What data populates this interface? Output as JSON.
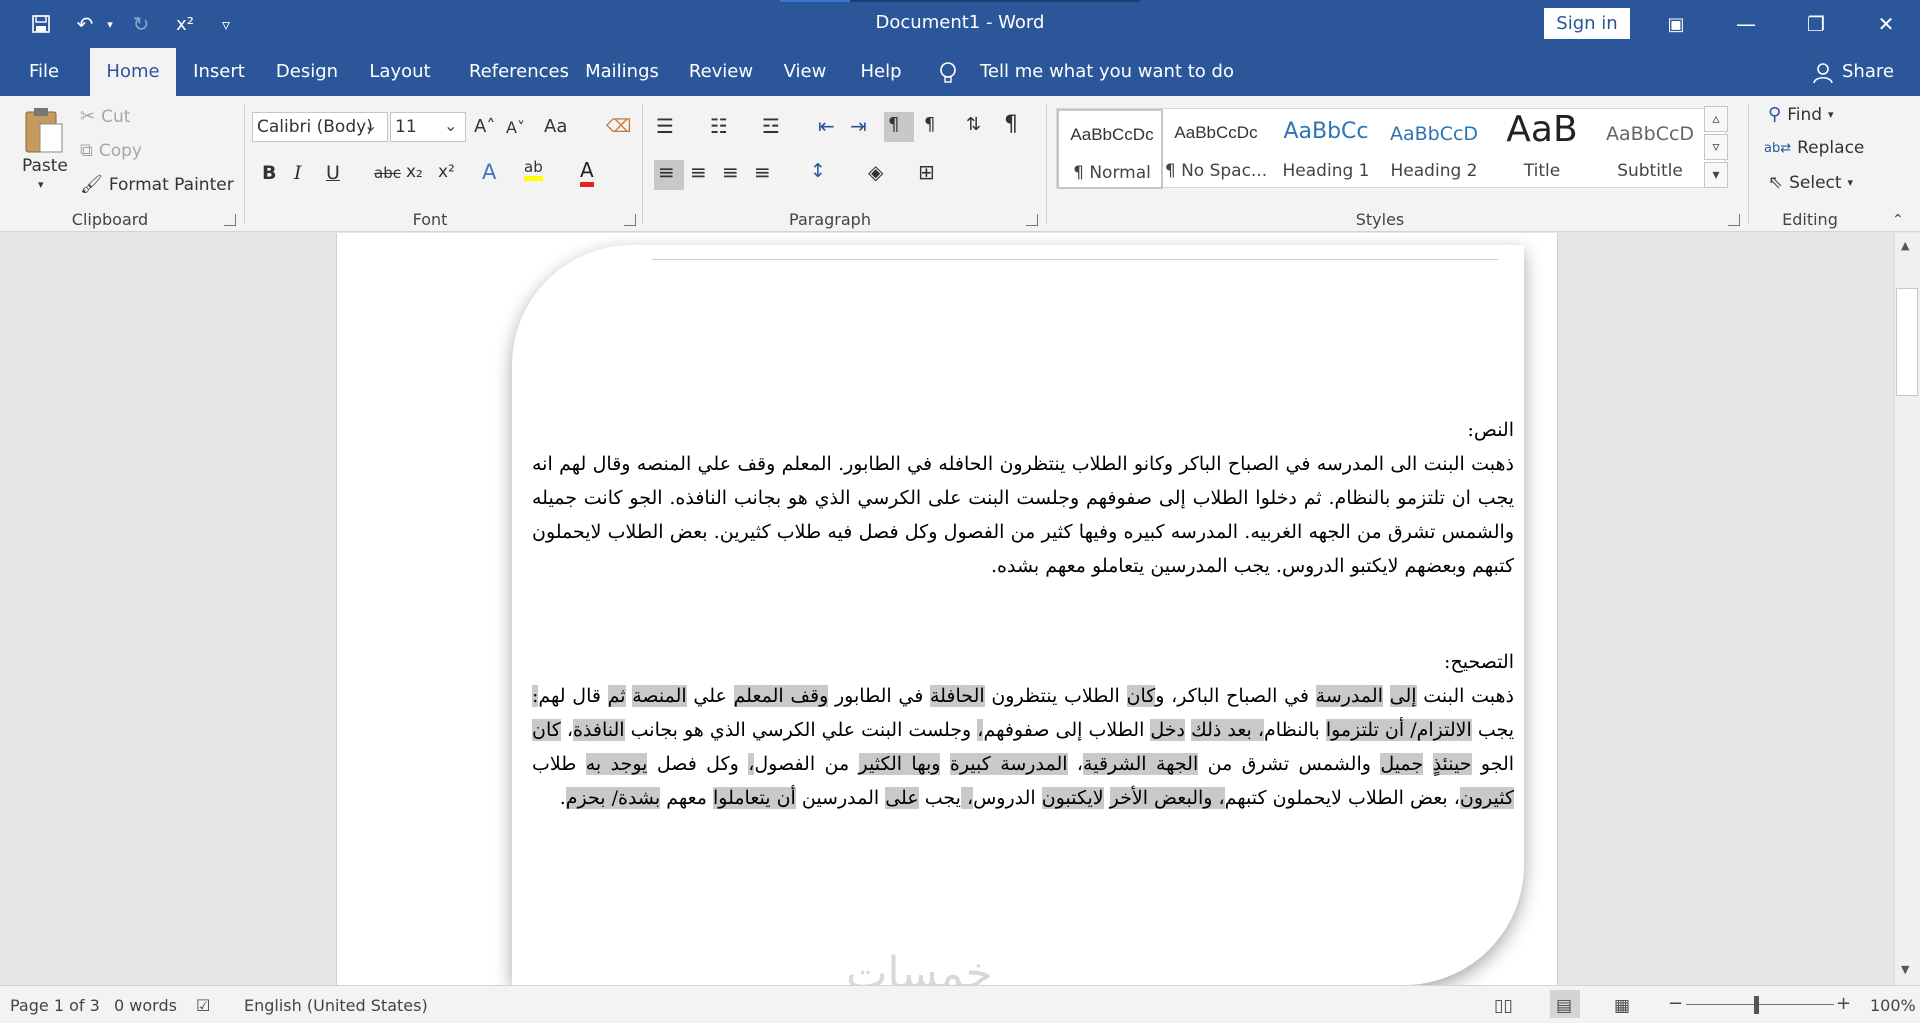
{
  "window": {
    "title": "Document1  -  Word",
    "sign_in": "Sign in",
    "minimize": "—",
    "restore": "❐",
    "close": "✕",
    "ribbon_display": "▣"
  },
  "quick_access": {
    "save_icon": "💾",
    "undo_icon": "↶",
    "undo_drop": "▾",
    "redo_icon": "↻",
    "superscript": "x²",
    "customize": "▿"
  },
  "tabs": [
    "File",
    "Home",
    "Insert",
    "Design",
    "Layout",
    "References",
    "Mailings",
    "Review",
    "View",
    "Help"
  ],
  "tell_me": "Tell me what you want to do",
  "share": "Share",
  "clipboard": {
    "paste": "Paste",
    "cut": "Cut",
    "copy": "Copy",
    "format_painter": "Format Painter",
    "label": "Clipboard"
  },
  "font": {
    "name": "Calibri (Body)",
    "size": "11",
    "label": "Font",
    "bold": "B",
    "italic": "I",
    "underline": "U",
    "strike": "abc",
    "subscript": "x₂",
    "superscript": "x²",
    "grow": "A˄",
    "shrink": "A˅",
    "case": "Aa",
    "text_effects": "A",
    "highlight": "ab",
    "font_color": "A"
  },
  "paragraph": {
    "label": "Paragraph"
  },
  "styles": {
    "label": "Styles",
    "items": [
      {
        "preview": "AaBbCcDc",
        "name": "¶ Normal"
      },
      {
        "preview": "AaBbCcDc",
        "name": "¶ No Spac..."
      },
      {
        "preview": "AaBbCc",
        "name": "Heading 1"
      },
      {
        "preview": "AaBbCcD",
        "name": "Heading 2"
      },
      {
        "preview": "AaB",
        "name": "Title"
      },
      {
        "preview": "AaBbCcD",
        "name": "Subtitle"
      }
    ]
  },
  "editing": {
    "find": "Find",
    "replace": "Replace",
    "select": "Select",
    "label": "Editing"
  },
  "document": {
    "heading1": "النص:",
    "text1": "ذهبت البنت الى المدرسه في الصباح الباكر وكانو الطلاب ينتظرون الحافله في الطابور. المعلم وقف علي المنصه وقال لهم انه يجب ان تلتزمو بالنظام. ثم دخلوا الطلاب إلى صفوفهم وجلست البنت على الكرسي الذي هو بجانب النافذه. الجو كانت جميله والشمس تشرق من الجهه الغربيه. المدرسه كبيره وفيها كثير من الفصول وكل فصل فيه طلاب كثيرين. بعض الطلاب لايحملون كتبهم وبعضهم لايكتبو الدروس. يجب المدرسين يتعاملو معهم بشده.",
    "heading2": "التصحيح:",
    "text2_parts": [
      "ذهبت البنت ",
      "إلى",
      " ",
      "المدرسة",
      " في الصباح الباكر، و",
      "كان",
      " الطلاب ينتظرون ",
      "الحافلة",
      " في الطابور ",
      "وقف المعلم",
      " علي ",
      "المنصة",
      " ",
      "ثم",
      " قال لهم",
      ":",
      " يجب ",
      "الالتزام/ أن تلتزموا",
      " بالنظام",
      "، بعد ذلك",
      " ",
      "دخل",
      " الطلاب إلى صفوفهم",
      "،",
      " وجلست البنت علي الكرسي الذي هو بجانب ",
      "النافذة",
      "، ",
      "كان",
      " الجو ",
      "حينئذٍ",
      " ",
      "جميل",
      " والشمس تشرق من ",
      "الجهة الشرقية",
      "، ",
      "المدرسة كبيرة",
      " ",
      "وبها الكثير",
      " من الفصول",
      "،",
      " وكل فصل ",
      "يوجد به",
      " طلاب ",
      "كثيرون",
      "، بعض الطلاب لايحملون كتبهم",
      "، ",
      "والبعض الأخر",
      " ",
      "لايكتبون",
      " الدروس",
      "، ",
      "يجب ",
      "على",
      " المدرسين ",
      "أن يتعاملوا",
      " معهم ",
      "بشدة/ بحزم",
      "."
    ]
  },
  "watermark": "خمسات",
  "status": {
    "page": "Page 1 of 3",
    "words": "0 words",
    "language": "English (United States)",
    "zoom": "100%",
    "zoom_minus": "−",
    "zoom_plus": "+"
  }
}
